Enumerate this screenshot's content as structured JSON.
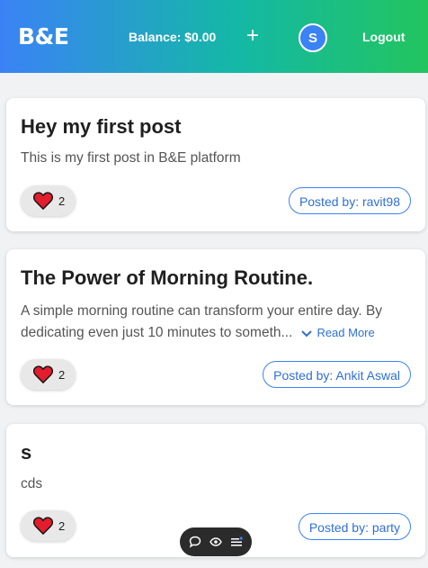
{
  "header": {
    "logo": "B&E",
    "balance": "Balance: $0.00",
    "add_label": "+",
    "avatar_initial": "S",
    "logout_label": "Logout"
  },
  "posts": [
    {
      "title": "Hey my first post",
      "body": "This is my first post in B&E platform",
      "likes": "2",
      "posted_by": "Posted by: ravit98"
    },
    {
      "title": "The Power of Morning Routine.",
      "body": "A simple morning routine can transform your entire day. By dedicating even just 10 minutes to someth...",
      "read_more": "Read More",
      "likes": "2",
      "posted_by": "Posted by: Ankit Aswal"
    },
    {
      "title": "s",
      "body": "cds",
      "likes": "2",
      "posted_by": "Posted by: party"
    }
  ],
  "floating_toolbar": {
    "icons": [
      "comment-icon",
      "eye-icon",
      "menu-icon"
    ]
  },
  "colors": {
    "accent": "#3b82f6",
    "gradient_start": "#3b82f6",
    "gradient_end": "#22c55e",
    "heart": "#e11d2e"
  }
}
